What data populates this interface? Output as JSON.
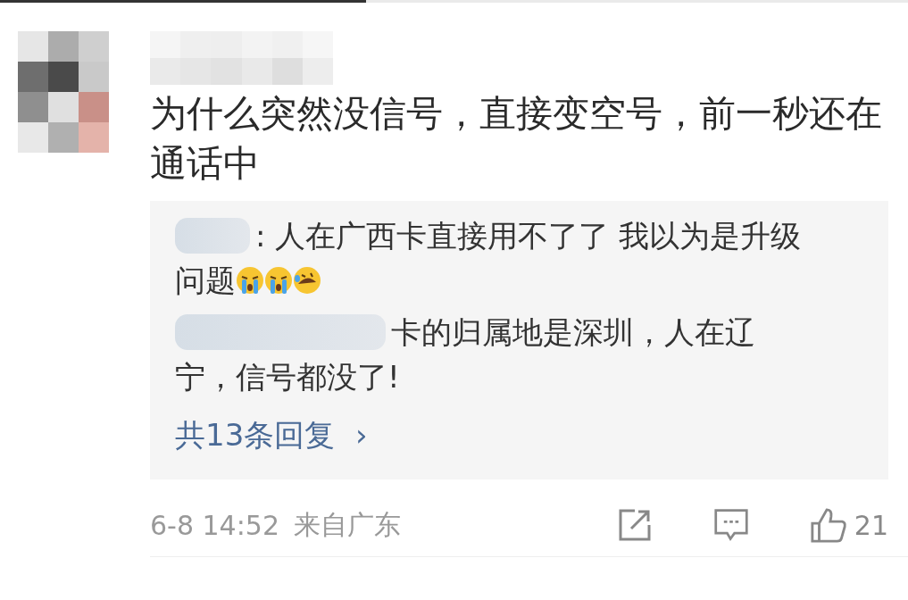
{
  "comment": {
    "text": "为什么突然没信号，直接变空号，前一秒还在通话中"
  },
  "replies": [
    {
      "lines": [
        ": 人在广西卡直接用不了了 我以为是升级",
        "问题"
      ],
      "emojis": [
        {
          "kind": "crying"
        },
        {
          "kind": "crying"
        },
        {
          "kind": "laughing"
        }
      ]
    },
    {
      "lines": [
        "卡的归属地是深圳，人在辽",
        "宁，信号都没了!"
      ]
    }
  ],
  "more_replies": "共13条回复",
  "more_arrow": "›",
  "footer": {
    "time": "6-8 14:52",
    "location": "来自广东",
    "likes": "21"
  }
}
